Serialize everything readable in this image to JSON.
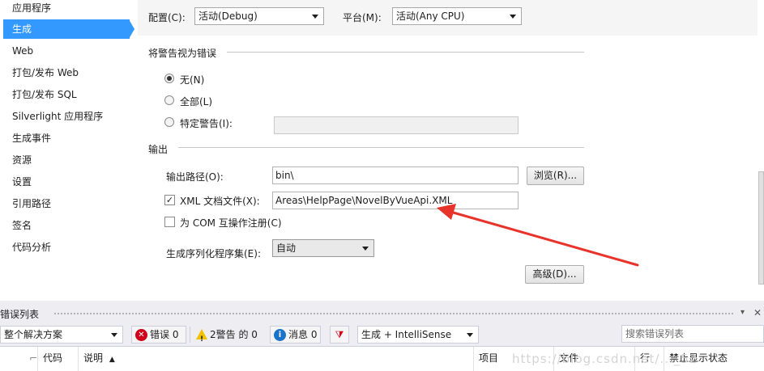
{
  "sidebar": {
    "items": [
      {
        "label": "应用程序"
      },
      {
        "label": "生成",
        "active": true
      },
      {
        "label": "Web"
      },
      {
        "label": "打包/发布 Web"
      },
      {
        "label": "打包/发布 SQL"
      },
      {
        "label": "Silverlight 应用程序"
      },
      {
        "label": "生成事件"
      },
      {
        "label": "资源"
      },
      {
        "label": "设置"
      },
      {
        "label": "引用路径"
      },
      {
        "label": "签名"
      },
      {
        "label": "代码分析"
      }
    ]
  },
  "config": {
    "configuration_label": "配置(C):",
    "configuration_value": "活动(Debug)",
    "platform_label": "平台(M):",
    "platform_value": "活动(Any CPU)"
  },
  "warnings_group": {
    "title": "将警告视为错误",
    "options": [
      {
        "label": "无(N)",
        "selected": true
      },
      {
        "label": "全部(L)",
        "selected": false
      },
      {
        "label": "特定警告(I):",
        "selected": false
      }
    ],
    "specific_value": ""
  },
  "output_group": {
    "title": "输出",
    "output_path_label": "输出路径(O):",
    "output_path_value": "bin\\",
    "browse_button": "浏览(R)...",
    "xml_doc_label": "XML 文档文件(X):",
    "xml_doc_checked": true,
    "xml_doc_value": "Areas\\HelpPage\\NovelByVueApi.XML",
    "com_label": "为 COM 互操作注册(C)",
    "com_checked": false,
    "serialization_label": "生成序列化程序集(E):",
    "serialization_value": "自动",
    "advanced_button": "高级(D)..."
  },
  "error_list": {
    "title": "错误列表",
    "scope_value": "整个解决方案",
    "errors_label": "错误 0",
    "warnings_label": "2警告 的 0",
    "messages_label": "消息 0",
    "build_filter_value": "生成 + IntelliSense",
    "search_placeholder": "搜索错误列表",
    "columns": [
      "代码",
      "说明",
      "项目",
      "文件",
      "行",
      "禁止显示状态"
    ]
  },
  "watermark": "https://blog.csdn.net/..._52",
  "colors": {
    "accent": "#3399ff",
    "error_icon": "#d0021b",
    "info_icon": "#1a73c9",
    "warning_icon": "#f2c200",
    "annotation_arrow": "#e8332a"
  }
}
